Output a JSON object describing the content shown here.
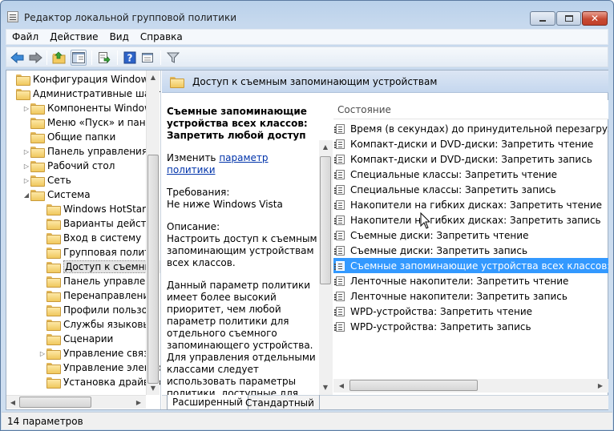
{
  "window": {
    "title": "Редактор локальной групповой политики",
    "controls": {
      "minimize": "minimize",
      "maximize": "maximize",
      "close": "✕"
    }
  },
  "menu": [
    "Файл",
    "Действие",
    "Вид",
    "Справка"
  ],
  "toolbar": {
    "buttons": [
      "back-icon",
      "forward-icon",
      "up-folder-icon",
      "show-hide-tree-icon",
      "export-list-icon",
      "help-icon",
      "properties-icon",
      "filter-icon"
    ]
  },
  "tree": {
    "items": [
      {
        "label": "Конфигурация Windows",
        "level": 0,
        "expander": ""
      },
      {
        "label": "Административные шабл",
        "level": 0,
        "expander": ""
      },
      {
        "label": "Компоненты Windows",
        "level": 1,
        "expander": "▷"
      },
      {
        "label": "Меню «Пуск» и панел",
        "level": 1,
        "expander": ""
      },
      {
        "label": "Общие папки",
        "level": 1,
        "expander": ""
      },
      {
        "label": "Панель управления",
        "level": 1,
        "expander": "▷"
      },
      {
        "label": "Рабочий стол",
        "level": 1,
        "expander": "▷"
      },
      {
        "label": "Сеть",
        "level": 1,
        "expander": "▷"
      },
      {
        "label": "Система",
        "level": 1,
        "expander": "◢"
      },
      {
        "label": "Windows HotStart",
        "level": 2,
        "expander": ""
      },
      {
        "label": "Варианты действи",
        "level": 2,
        "expander": ""
      },
      {
        "label": "Вход в систему",
        "level": 2,
        "expander": ""
      },
      {
        "label": "Групповая полити",
        "level": 2,
        "expander": ""
      },
      {
        "label": "Доступ к съемным",
        "level": 2,
        "expander": "",
        "selected": true
      },
      {
        "label": "Панель управлени",
        "level": 2,
        "expander": ""
      },
      {
        "label": "Перенаправление",
        "level": 2,
        "expander": ""
      },
      {
        "label": "Профили пользов",
        "level": 2,
        "expander": ""
      },
      {
        "label": "Службы языковых",
        "level": 2,
        "expander": ""
      },
      {
        "label": "Сценарии",
        "level": 2,
        "expander": ""
      },
      {
        "label": "Управление связь",
        "level": 2,
        "expander": "▷"
      },
      {
        "label": "Управление электр",
        "level": 2,
        "expander": ""
      },
      {
        "label": "Установка драйвер",
        "level": 2,
        "expander": ""
      }
    ]
  },
  "detail": {
    "header_title": "Доступ к съемным запоминающим устройствам",
    "description": {
      "title": "Съемные запоминающие устройства всех классов: Запретить любой доступ",
      "edit_prefix": "Изменить ",
      "edit_link": "параметр политики",
      "requirements_label": "Требования:",
      "requirements_value": "Не ниже Windows Vista",
      "description_label": "Описание:",
      "description_text": "Настроить доступ к съемным запоминающим устройствам всех классов.",
      "details_text": "Данный параметр политики имеет более высокий приоритет, чем любой параметр политики для отдельного съемного запоминающего устройства. Для управления отдельными классами следует использовать параметры политики, доступные для каждого из"
    },
    "list": {
      "column_header": "Состояние",
      "items": [
        "Время (в секундах) до принудительной перезагрузки",
        "Компакт-диски и DVD-диски: Запретить чтение",
        "Компакт-диски и DVD-диски: Запретить запись",
        "Специальные классы: Запретить чтение",
        "Специальные классы: Запретить запись",
        "Накопители на гибких дисках: Запретить чтение",
        "Накопители на гибких дисках: Запретить запись",
        "Съемные диски: Запретить чтение",
        "Съемные диски: Запретить запись",
        "Съемные запоминающие устройства всех классов: Запр...",
        "Ленточные накопители: Запретить чтение",
        "Ленточные накопители: Запретить запись",
        "WPD-устройства: Запретить чтение",
        "WPD-устройства: Запретить запись"
      ],
      "selected_index": 9
    },
    "tabs": [
      "Расширенный",
      "Стандартный"
    ],
    "active_tab": "Расширенный"
  },
  "status": {
    "text": "14 параметров"
  }
}
